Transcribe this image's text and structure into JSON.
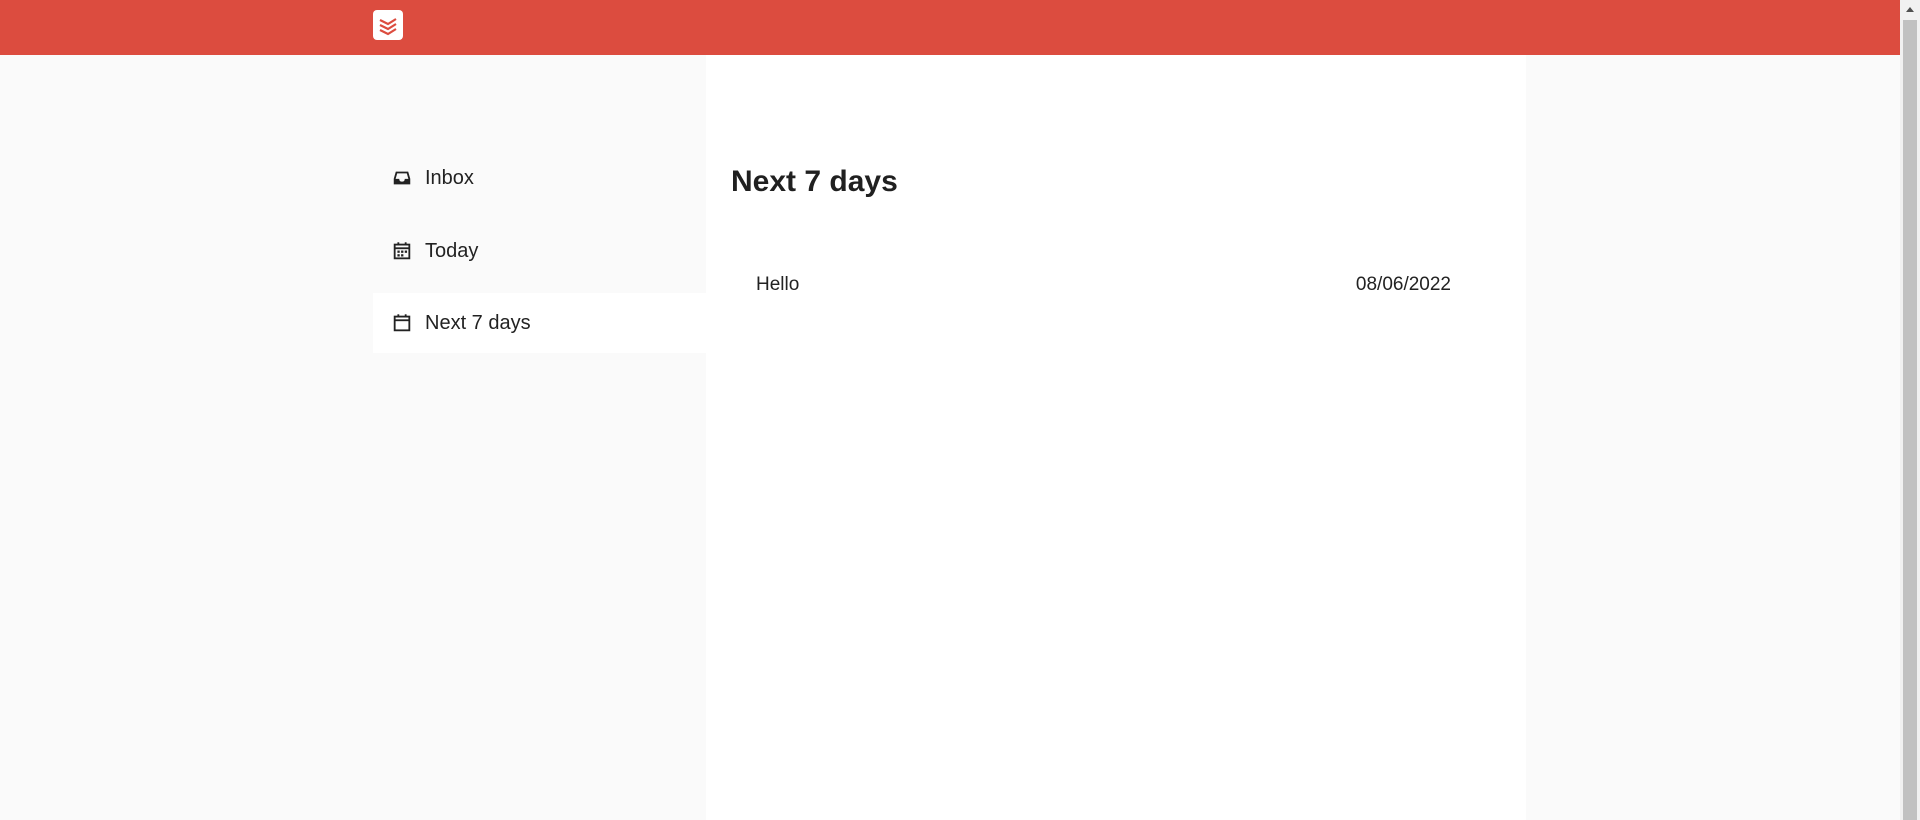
{
  "header": {
    "logo_icon": "todoist-logo-icon",
    "brand_color": "#dc4c3f"
  },
  "sidebar": {
    "items": [
      {
        "label": "Inbox",
        "icon": "inbox-icon",
        "active": false
      },
      {
        "label": "Today",
        "icon": "calendar-grid-icon",
        "active": false
      },
      {
        "label": "Next 7 days",
        "icon": "calendar-icon",
        "active": true
      }
    ]
  },
  "main": {
    "title": "Next 7 days",
    "tasks": [
      {
        "name": "Hello",
        "date": "08/06/2022"
      }
    ]
  }
}
